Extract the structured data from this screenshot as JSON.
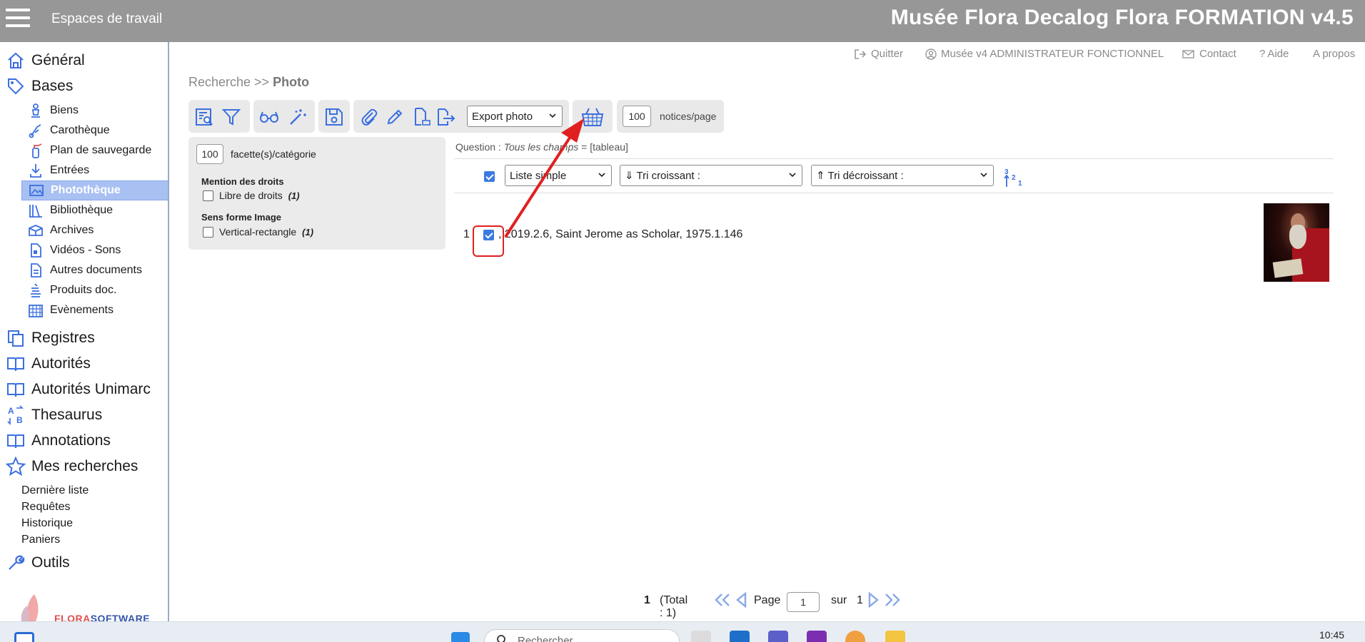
{
  "header": {
    "workspaces_label": "Espaces de travail",
    "app_title": "Musée Flora Decalog Flora FORMATION v4.5"
  },
  "sidebar": {
    "top_items": [
      {
        "label": "Général",
        "icon": "home-icon"
      },
      {
        "label": "Bases",
        "icon": "tag-icon"
      },
      {
        "label": "Registres",
        "icon": "registers-icon"
      },
      {
        "label": "Autorités",
        "icon": "book-icon"
      },
      {
        "label": "Autorités Unimarc",
        "icon": "book-icon"
      },
      {
        "label": "Thesaurus",
        "icon": "thesaurus-icon"
      },
      {
        "label": "Annotations",
        "icon": "book-icon"
      },
      {
        "label": "Mes recherches",
        "icon": "star-icon"
      },
      {
        "label": "Outils",
        "icon": "wrench-icon"
      }
    ],
    "bases_items": [
      {
        "label": "Biens",
        "icon": "statue-icon"
      },
      {
        "label": "Carothèque",
        "icon": "map-pin-icon"
      },
      {
        "label": "Plan de sauvegarde",
        "icon": "extinguisher-icon"
      },
      {
        "label": "Entrées",
        "icon": "download-icon"
      },
      {
        "label": "Photothèque",
        "icon": "image-icon",
        "active": true
      },
      {
        "label": "Bibliothèque",
        "icon": "books-icon"
      },
      {
        "label": "Archives",
        "icon": "archive-box-icon"
      },
      {
        "label": "Vidéos - Sons",
        "icon": "video-file-icon"
      },
      {
        "label": "Autres documents",
        "icon": "document-icon"
      },
      {
        "label": "Produits doc.",
        "icon": "stack-icon"
      },
      {
        "label": "Evènements",
        "icon": "calendar-icon"
      }
    ],
    "searches_items": [
      "Dernière liste",
      "Requêtes",
      "Historique",
      "Paniers"
    ],
    "logo_text_a": "FLORA",
    "logo_text_b": "SOFTWARE"
  },
  "top_links": {
    "quit": "Quitter",
    "user": "Musée v4 ADMINISTRATEUR FONCTIONNEL",
    "contact": "Contact",
    "help": "Aide",
    "about": "A propos"
  },
  "breadcrumb": {
    "prefix": "Recherche >> ",
    "current": "Photo"
  },
  "toolbar": {
    "export_select": "Export photo",
    "per_page_value": "100",
    "per_page_label": "notices/page"
  },
  "facets": {
    "per_category_value": "100",
    "per_category_label": "facette(s)/catégorie",
    "groups": [
      {
        "title": "Mention des droits",
        "option": "Libre de droits",
        "count": "(1)"
      },
      {
        "title": "Sens forme Image",
        "option": "Vertical-rectangle",
        "count": "(1)"
      }
    ]
  },
  "results": {
    "question_label": "Question : ",
    "question_fields": "Tous les champs",
    "question_value": " = [tableau]",
    "list_mode": "Liste simple",
    "sort_asc": "⇓ Tri croissant :",
    "sort_desc": "⇑ Tri décroissant :",
    "rows": [
      {
        "index": "1",
        "text": ", 2019.2.6, Saint Jerome as Scholar, 1975.1.146",
        "checked": true
      }
    ]
  },
  "pager": {
    "current": "1",
    "total": "(Total : 1)",
    "page_label": "Page",
    "page_value": "1",
    "of_label": "sur",
    "of_value": "1"
  },
  "taskbar": {
    "search_placeholder": "Rechercher",
    "time": "10:45"
  },
  "colors": {
    "accent": "#3b6fe0",
    "topbar": "#979797",
    "active_nav": "#a9c0f3",
    "annotation_red": "#e02020"
  }
}
